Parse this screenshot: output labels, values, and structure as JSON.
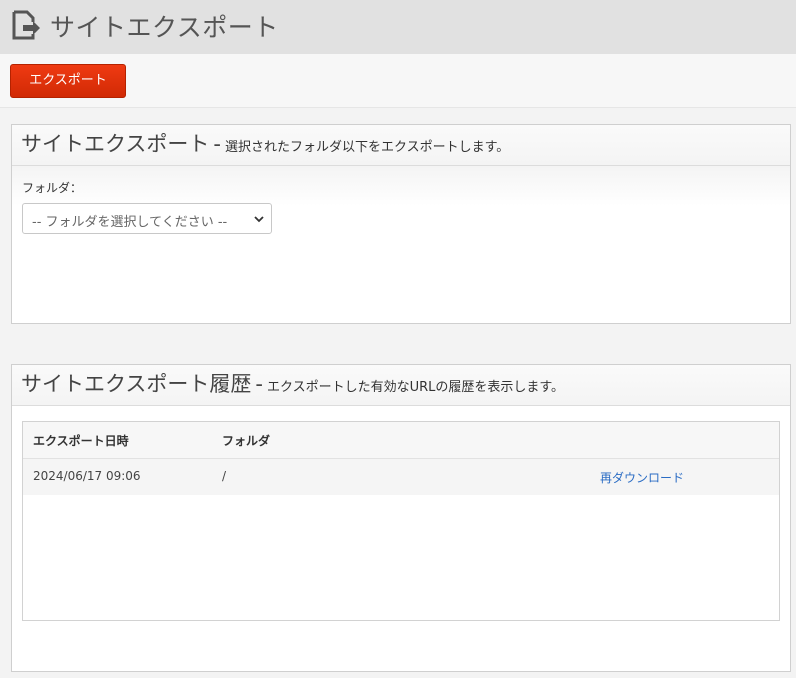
{
  "header": {
    "title": "サイトエクスポート",
    "icon": "export-file-icon"
  },
  "toolbar": {
    "export_label": "エクスポート",
    "export_color": "#e0300a"
  },
  "export_panel": {
    "title": "サイトエクスポート",
    "separator": "-",
    "description": "選択されたフォルダ以下をエクスポートします。",
    "folder_label": "フォルダ：",
    "folder_select": {
      "selected": "-- フォルダを選択してください --",
      "icon": "chevron-down-icon"
    }
  },
  "history_panel": {
    "title": "サイトエクスポート履歴",
    "separator": "-",
    "description": "エクスポートした有効なURLの履歴を表示します。",
    "columns": [
      "エクスポート日時",
      "フォルダ"
    ],
    "rows": [
      {
        "date": "2024/06/17 09:06",
        "folder": "/",
        "action": "再ダウンロード"
      }
    ],
    "link_color": "#2a6cc4"
  }
}
